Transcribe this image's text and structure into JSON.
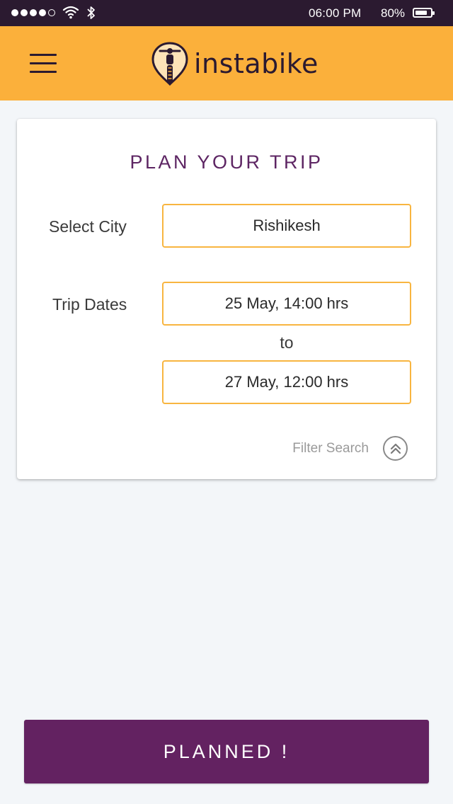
{
  "status_bar": {
    "time": "06:00 PM",
    "battery": "80%",
    "battery_level": 0.8,
    "signal_icon": "signal-dots-icon",
    "wifi_icon": "wifi-icon",
    "bluetooth_icon": "bluetooth-icon"
  },
  "header": {
    "menu_icon": "hamburger-menu-icon",
    "logo_icon": "location-pin-bike-icon",
    "brand": "instabike",
    "background": "#fbb03b"
  },
  "form": {
    "title": "PLAN YOUR TRIP",
    "city_label": "Select City",
    "city_value": "Rishikesh",
    "dates_label": "Trip Dates",
    "start_date": "25 May, 14:00 hrs",
    "to_text": "to",
    "end_date": "27 May, 12:00 hrs",
    "filter_label": "Filter Search",
    "filter_icon": "double-chevron-up-circle-icon",
    "accent": "#5d2563",
    "field_border": "#f8b540"
  },
  "footer": {
    "planned_label": "PLANNED !",
    "background": "#632261"
  }
}
